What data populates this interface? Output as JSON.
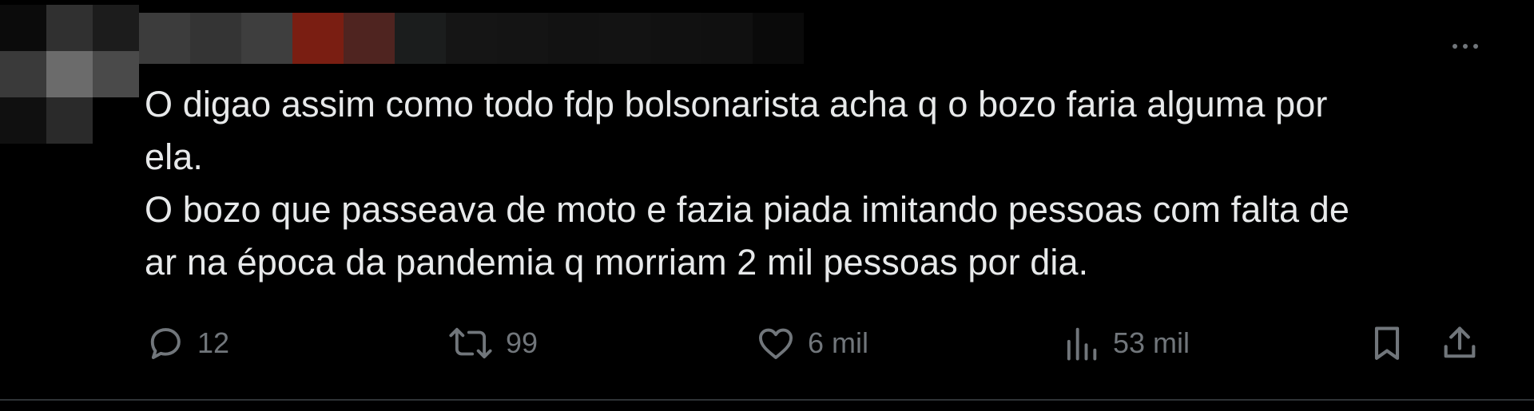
{
  "post": {
    "text_lines": [
      "O digao assim como todo fdp bolsonarista acha q o bozo faria alguma por",
      "ela.",
      "O bozo que passeava de moto e fazia piada imitando pessoas com falta de",
      "ar na época da pandemia q morriam 2 mil pessoas por dia."
    ],
    "more_icon": "more-horizontal-icon"
  },
  "actions": {
    "reply": {
      "count": "12",
      "icon": "reply-icon"
    },
    "repost": {
      "count": "99",
      "icon": "repost-icon"
    },
    "like": {
      "count": "6 mil",
      "icon": "heart-icon"
    },
    "views": {
      "count": "53 mil",
      "icon": "bar-chart-icon"
    },
    "bookmark": {
      "icon": "bookmark-icon"
    },
    "share": {
      "icon": "share-icon"
    }
  },
  "colors": {
    "background": "#000000",
    "text": "#e7e9ea",
    "muted": "#71767b",
    "divider": "#2f3336"
  }
}
